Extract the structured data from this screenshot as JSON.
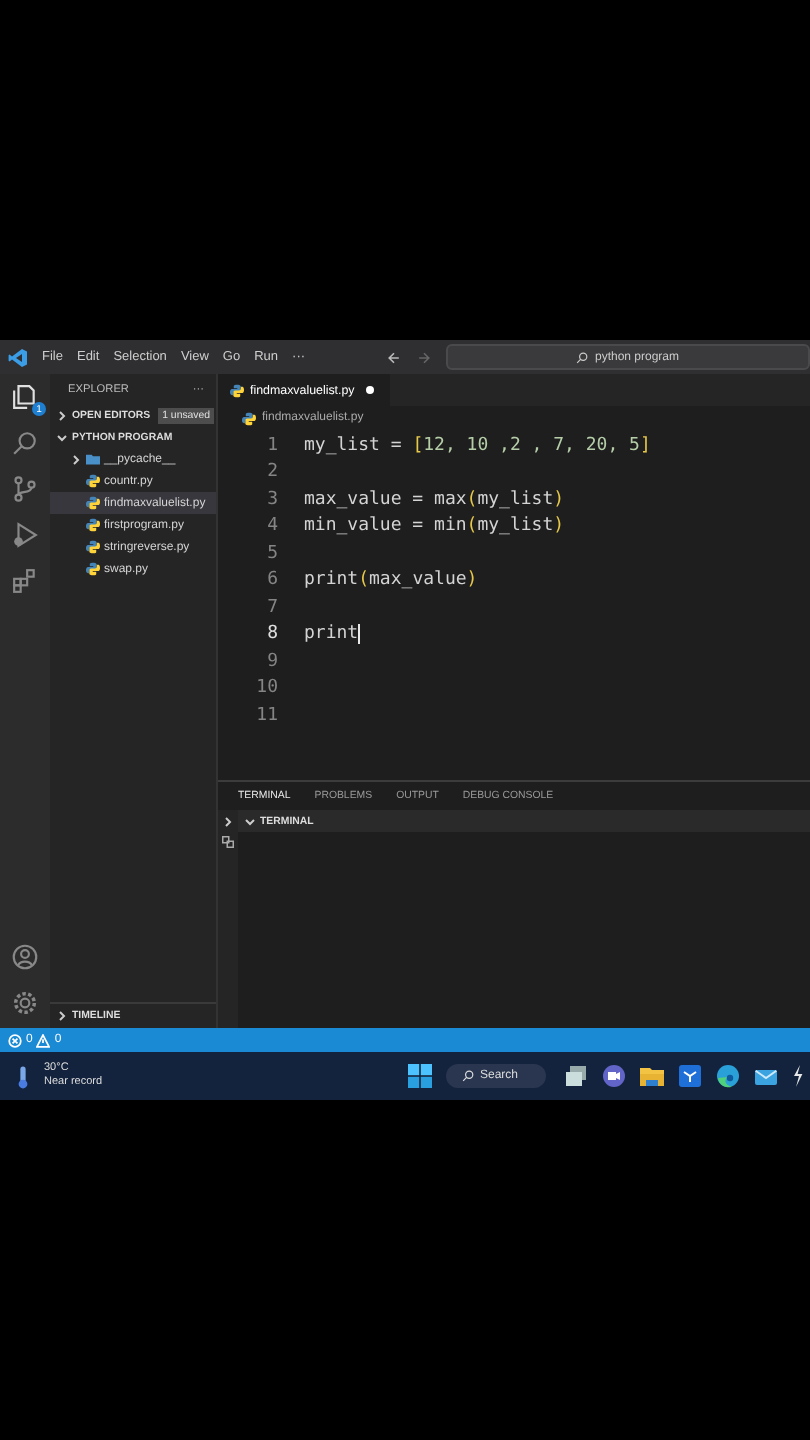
{
  "menu": [
    "File",
    "Edit",
    "Selection",
    "View",
    "Go",
    "Run",
    "···"
  ],
  "search": {
    "value": "python program"
  },
  "activity_bar": {
    "explorer_badge": "1"
  },
  "sidebar": {
    "title": "EXPLORER",
    "more": "···",
    "open_editors": {
      "label": "OPEN EDITORS",
      "badge": "1 unsaved",
      "expanded": false
    },
    "project": {
      "label": "PYTHON PROGRAM",
      "expanded": true,
      "children": [
        {
          "kind": "folder",
          "name": "__pycache__",
          "expanded": false,
          "selected": false
        },
        {
          "kind": "file",
          "name": "countr.py",
          "selected": false
        },
        {
          "kind": "file",
          "name": "findmaxvaluelist.py",
          "selected": true
        },
        {
          "kind": "file",
          "name": "firstprogram.py",
          "selected": false
        },
        {
          "kind": "file",
          "name": "stringreverse.py",
          "selected": false
        },
        {
          "kind": "file",
          "name": "swap.py",
          "selected": false
        }
      ]
    },
    "timeline": {
      "label": "TIMELINE",
      "expanded": false
    }
  },
  "editor": {
    "tab": {
      "name": "findmaxvaluelist.py",
      "unsaved": true
    },
    "breadcrumb": "findmaxvaluelist.py",
    "lines": [
      {
        "number": "1",
        "active": false,
        "tokens": [
          {
            "kind": "plain",
            "text": "my_list = "
          },
          {
            "kind": "bracket",
            "text": "["
          },
          {
            "kind": "number",
            "text": "12, 10 ,2 , 7, 20, 5"
          },
          {
            "kind": "bracket",
            "text": "]"
          }
        ]
      },
      {
        "number": "2",
        "active": false
      },
      {
        "number": "3",
        "active": false,
        "tokens": [
          {
            "kind": "plain",
            "text": "max_value = max"
          },
          {
            "kind": "bracket",
            "text": "("
          },
          {
            "kind": "plain",
            "text": "my_list"
          },
          {
            "kind": "bracket",
            "text": ")"
          }
        ]
      },
      {
        "number": "4",
        "active": false,
        "tokens": [
          {
            "kind": "plain",
            "text": "min_value = min"
          },
          {
            "kind": "bracket",
            "text": "("
          },
          {
            "kind": "plain",
            "text": "my_list"
          },
          {
            "kind": "bracket",
            "text": ")"
          }
        ]
      },
      {
        "number": "5",
        "active": false
      },
      {
        "number": "6",
        "active": false,
        "tokens": [
          {
            "kind": "plain",
            "text": "print"
          },
          {
            "kind": "bracket",
            "text": "("
          },
          {
            "kind": "plain",
            "text": "max_value"
          },
          {
            "kind": "bracket",
            "text": ")"
          }
        ]
      },
      {
        "number": "7",
        "active": false
      },
      {
        "number": "8",
        "active": true,
        "cursor": true,
        "tokens": [
          {
            "kind": "plain",
            "text": "print"
          }
        ]
      },
      {
        "number": "9",
        "active": false
      },
      {
        "number": "10",
        "active": false
      },
      {
        "number": "11",
        "active": false
      }
    ]
  },
  "panel": {
    "tabs": [
      {
        "label": "TERMINAL",
        "selected": true
      },
      {
        "label": "PROBLEMS",
        "selected": false
      },
      {
        "label": "OUTPUT",
        "selected": false
      },
      {
        "label": "DEBUG CONSOLE",
        "selected": false
      }
    ],
    "section": {
      "label": "TERMINAL",
      "expanded": true
    }
  },
  "status_bar": {
    "errors": "0",
    "warnings": "0"
  },
  "taskbar": {
    "temperature": "30°C",
    "weather": "Near record",
    "search": "Search"
  }
}
